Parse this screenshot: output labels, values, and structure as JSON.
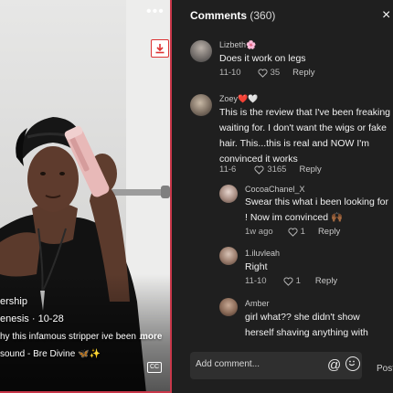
{
  "video": {
    "caption_user": "ership",
    "caption_date": "enesis · 10-28",
    "caption_text": "hy this infamous stripper ive been ...",
    "more_label": "more",
    "sound_label": "sound - Bre Divine 🦋✨",
    "cc_label": "CC"
  },
  "comments_panel": {
    "title": "Comments",
    "count": "(360)",
    "close_label": "×",
    "input_placeholder": "Add comment...",
    "post_label": "Post",
    "comments": [
      {
        "user": "Lizbeth🌸",
        "text": "Does it work on legs",
        "date": "11-10",
        "likes": "35",
        "reply": "Reply"
      },
      {
        "user": "Zoey❤️🤍",
        "text": "This is the review that I've been freaking waiting for. I don't want the wigs or fake hair. This...this is real and NOW I'm convinced it works",
        "date": "11-6",
        "likes": "3165",
        "reply": "Reply"
      },
      {
        "user": "CocoaChanel_X",
        "text": "Swear this what i been looking for ! Now im convinced 🙌🏾",
        "date": "1w ago",
        "likes": "1",
        "reply": "Reply"
      },
      {
        "user": "1.iluvleah",
        "text": "Right",
        "date": "11-10",
        "likes": "1",
        "reply": "Reply"
      },
      {
        "user": "Amber",
        "text": "girl what?? she didn't show herself shaving anything with",
        "date": "",
        "likes": "",
        "reply": ""
      }
    ]
  }
}
